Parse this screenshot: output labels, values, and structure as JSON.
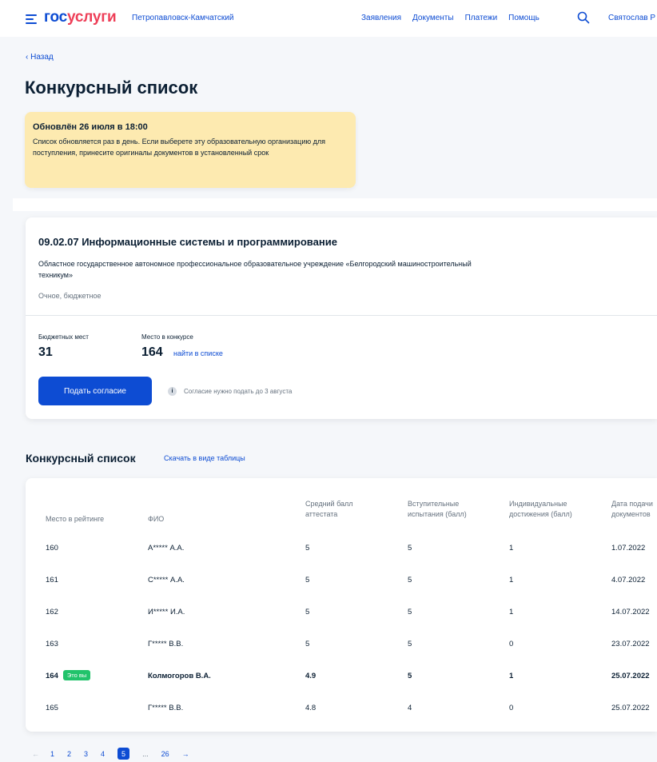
{
  "header": {
    "logo_part1": "гос",
    "logo_part2": "услуги",
    "region": "Петропавловск-Камчатский",
    "nav": [
      "Заявления",
      "Документы",
      "Платежи",
      "Помощь"
    ],
    "user": "Святослав Р"
  },
  "back_label": "‹ Назад",
  "page_title": "Конкурсный список",
  "notice": {
    "heading": "Обновлён 26 июля в 18:00",
    "text": "Список обновляется раз в день. Если выберете эту образовательную организацию для поступления, принесите оригиналы документов в установленный срок"
  },
  "program": {
    "code_name": "09.02.07 Информационные системы и программирование",
    "organization": "Областное государственное автономное профессиональное образовательное учреждение «Белгородский машиностроительный техникум»",
    "form": "Очное, бюджетное",
    "budget_label": "Бюджетных мест",
    "budget_value": "31",
    "rank_label": "Место в конкурсе",
    "rank_value": "164",
    "find_link": "найти в списке",
    "consent_button": "Подать согласие",
    "consent_hint": "Согласие нужно подать до 3 августа"
  },
  "list": {
    "title": "Конкурсный список",
    "download_link": "Скачать в виде таблицы",
    "columns": [
      "Место в рейтинге",
      "ФИО",
      "Средний балл аттестата",
      "Вступительные испытания (балл)",
      "Индивидуальные достижения (балл)",
      "Дата подачи документов"
    ],
    "you_badge": "Это вы",
    "rows": [
      {
        "place": "160",
        "name": "А***** А.А.",
        "gpa": "5",
        "exam": "5",
        "achievements": "1",
        "date": "1.07.2022",
        "me": false
      },
      {
        "place": "161",
        "name": "С***** А.А.",
        "gpa": "5",
        "exam": "5",
        "achievements": "1",
        "date": "4.07.2022",
        "me": false
      },
      {
        "place": "162",
        "name": "И***** И.А.",
        "gpa": "5",
        "exam": "5",
        "achievements": "1",
        "date": "14.07.2022",
        "me": false
      },
      {
        "place": "163",
        "name": "Г***** В.В.",
        "gpa": "5",
        "exam": "5",
        "achievements": "0",
        "date": "23.07.2022",
        "me": false
      },
      {
        "place": "164",
        "name": "Колмогоров В.А.",
        "gpa": "4.9",
        "exam": "5",
        "achievements": "1",
        "date": "25.07.2022",
        "me": true
      },
      {
        "place": "165",
        "name": "Г***** В.В.",
        "gpa": "4.8",
        "exam": "4",
        "achievements": "0",
        "date": "25.07.2022",
        "me": false
      }
    ]
  },
  "pagination": {
    "prev": "←",
    "pages": [
      "1",
      "2",
      "3",
      "4"
    ],
    "current": "5",
    "ellipsis": "...",
    "last": "26",
    "next": "→"
  },
  "colors": {
    "primary": "#0d4cd3",
    "logo_accent": "#ee3f58",
    "notice_bg": "#fdeab0",
    "badge_green": "#21c36b"
  }
}
